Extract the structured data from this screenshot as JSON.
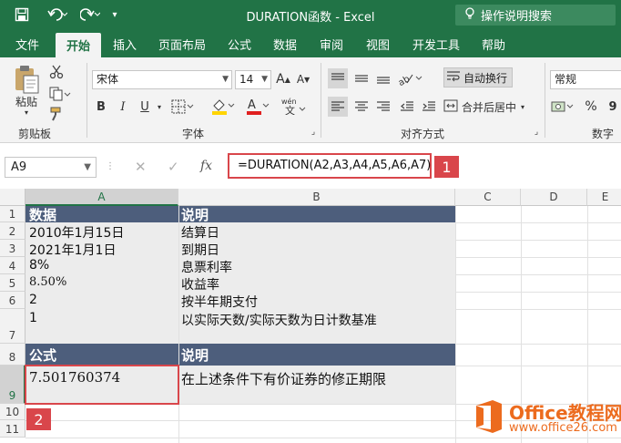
{
  "window": {
    "title": "DURATION函数  -  Excel",
    "tell_me": "操作说明搜索"
  },
  "qat": {
    "save_icon": "save-icon",
    "undo_icon": "undo-icon",
    "redo_icon": "redo-icon",
    "customize_icon": "customize-icon"
  },
  "tabs": [
    "文件",
    "开始",
    "插入",
    "页面布局",
    "公式",
    "数据",
    "审阅",
    "视图",
    "开发工具",
    "帮助"
  ],
  "active_tab": "开始",
  "ribbon": {
    "clipboard": {
      "paste": "粘贴",
      "label": "剪贴板"
    },
    "font": {
      "name": "宋体",
      "size": "14",
      "bold": "B",
      "italic": "I",
      "underline": "U",
      "label": "字体"
    },
    "alignment": {
      "wrap": "自动换行",
      "merge": "合并后居中",
      "label": "对齐方式"
    },
    "number": {
      "format": "常规",
      "percent": "%",
      "comma": "9",
      "label": "数字"
    }
  },
  "formula_bar": {
    "name_box": "A9",
    "cancel": "✕",
    "enter": "✓",
    "fx": "fx",
    "formula": "=DURATION(A2,A3,A4,A5,A6,A7)",
    "badge": "1"
  },
  "grid": {
    "columns": [
      "A",
      "B",
      "C",
      "D",
      "E"
    ],
    "rows": [
      "1",
      "2",
      "3",
      "4",
      "5",
      "6",
      "7",
      "8",
      "9",
      "10",
      "11"
    ],
    "cells": {
      "A1": "数据",
      "B1": "说明",
      "A2": "2010年1月15日",
      "B2": "结算日",
      "A3": "2021年1月1日",
      "B3": "到期日",
      "A4": "8%",
      "B4": "息票利率",
      "A5": "8.50%",
      "B5": "收益率",
      "A6": "2",
      "B6": "按半年期支付",
      "A7": "1",
      "B7": "以实际天数/实际天数为日计数基准",
      "A8": "公式",
      "B8": "说明",
      "A9": "7.501760374",
      "B9": "在上述条件下有价证券的修正期限"
    },
    "badge": "2",
    "header_color": "#4d5e7c",
    "accent_color": "#217346",
    "highlight_color": "#d9464b"
  },
  "watermark": {
    "title": "Office教程网",
    "url": "www.office26.com"
  }
}
